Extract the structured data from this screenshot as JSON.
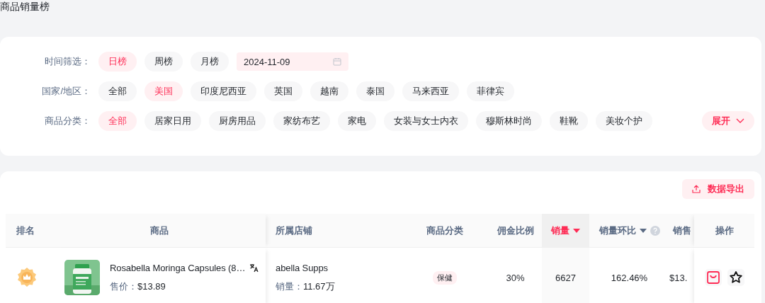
{
  "page_title": "商品销量榜",
  "filter_panel": {
    "rows": [
      {
        "label": "时间筛选：",
        "options": [
          {
            "label": "日榜",
            "selected": true
          },
          {
            "label": "周榜",
            "selected": false
          },
          {
            "label": "月榜",
            "selected": false
          }
        ],
        "date": {
          "value": "2024-11-09"
        }
      },
      {
        "label": "国家/地区：",
        "options": [
          {
            "label": "全部",
            "selected": false
          },
          {
            "label": "美国",
            "selected": true
          },
          {
            "label": "印度尼西亚",
            "selected": false
          },
          {
            "label": "英国",
            "selected": false
          },
          {
            "label": "越南",
            "selected": false
          },
          {
            "label": "泰国",
            "selected": false
          },
          {
            "label": "马来西亚",
            "selected": false
          },
          {
            "label": "菲律宾",
            "selected": false
          }
        ]
      },
      {
        "label": "商品分类：",
        "options": [
          {
            "label": "全部",
            "selected": true
          },
          {
            "label": "居家日用",
            "selected": false
          },
          {
            "label": "厨房用品",
            "selected": false
          },
          {
            "label": "家纺布艺",
            "selected": false
          },
          {
            "label": "家电",
            "selected": false
          },
          {
            "label": "女装与女士内衣",
            "selected": false
          },
          {
            "label": "穆斯林时尚",
            "selected": false
          },
          {
            "label": "鞋靴",
            "selected": false
          },
          {
            "label": "美妆个护",
            "selected": false
          }
        ]
      }
    ],
    "expand_label": "展开"
  },
  "export_button": "数据导出",
  "table": {
    "columns": [
      {
        "label": "排名",
        "sortable": false,
        "sorted": false,
        "help": false
      },
      {
        "label": "商品",
        "sortable": false,
        "sorted": false,
        "help": false
      },
      {
        "label": "所属店铺",
        "sortable": false,
        "sorted": false,
        "help": false
      },
      {
        "label": "商品分类",
        "sortable": false,
        "sorted": false,
        "help": false
      },
      {
        "label": "佣金比例",
        "sortable": false,
        "sorted": false,
        "help": false
      },
      {
        "label": "销量",
        "sortable": true,
        "sorted": true,
        "help": false
      },
      {
        "label": "销量环比",
        "sortable": true,
        "sorted": false,
        "help": true
      },
      {
        "label": "销售",
        "sortable": false,
        "sorted": false,
        "help": false
      },
      {
        "label": "操作",
        "sortable": false,
        "sorted": false,
        "help": false
      }
    ],
    "rows": [
      {
        "product": {
          "name": "Rosabella Moringa Capsules (8…",
          "price_label": "售价：",
          "price": "$13.89"
        },
        "store": {
          "name": "abella Supps",
          "sales_label": "销量：",
          "sales": "11.67万"
        },
        "category": "保健",
        "commission": "30%",
        "sales": "6627",
        "sales_growth": "162.46%",
        "revenue": "$13."
      }
    ]
  }
}
